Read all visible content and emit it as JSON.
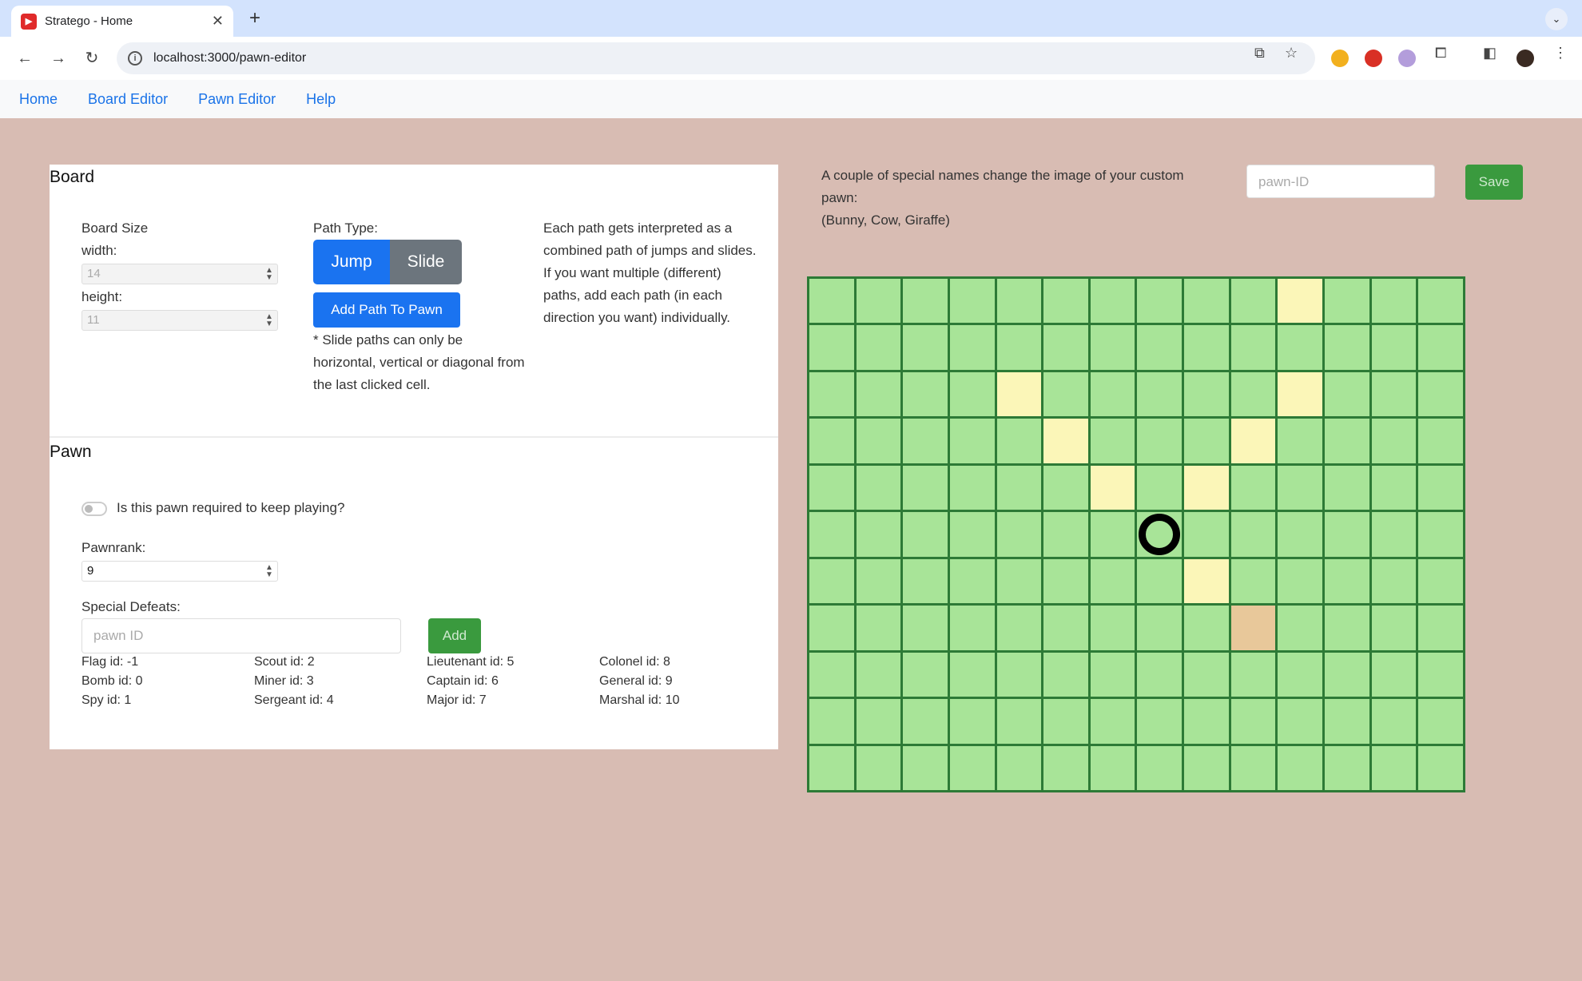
{
  "browser": {
    "tab_title": "Stratego - Home",
    "tab_close": "✕",
    "new_tab": "+",
    "url": "localhost:3000/pawn-editor"
  },
  "nav": {
    "links": [
      "Home",
      "Board Editor",
      "Pawn Editor",
      "Help"
    ]
  },
  "board_section": {
    "title": "Board",
    "board_size_label": "Board Size",
    "width_label": "width:",
    "width_value": "14",
    "height_label": "height:",
    "height_value": "11",
    "path_type_label": "Path Type:",
    "jump_label": "Jump",
    "slide_label": "Slide",
    "add_path_label": "Add Path To Pawn",
    "slide_note": "* Slide paths can only be horizontal, vertical or diagonal from the last clicked cell.",
    "path_info": "Each path gets interpreted as a combined path of jumps and slides. If you want multiple (different) paths, add each path (in each direction you want) individually."
  },
  "pawn_section": {
    "title": "Pawn",
    "required_label": "Is this pawn required to keep playing?",
    "required": false,
    "pawnrank_label": "Pawnrank:",
    "pawnrank_value": "9",
    "special_defeats_label": "Special Defeats:",
    "special_defeats_placeholder": "pawn ID",
    "add_label": "Add",
    "ids": [
      "Flag id: -1",
      "Scout id: 2",
      "Lieutenant id: 5",
      "Colonel id: 8",
      "Bomb id: 0",
      "Miner id: 3",
      "Captain id: 6",
      "General id: 9",
      "Spy id: 1",
      "Sergeant id: 4",
      "Major id: 7",
      "Marshal id: 10"
    ]
  },
  "right": {
    "note_line1": "A couple of special names change the image of your custom pawn:",
    "note_line2": "(Bunny, Cow, Giraffe)",
    "id_placeholder": "pawn-ID",
    "save_label": "Save"
  },
  "grid": {
    "cols": 14,
    "rows": 11,
    "pawn": [
      5,
      7
    ],
    "path_cells": [
      [
        0,
        10
      ],
      [
        2,
        4
      ],
      [
        2,
        10
      ],
      [
        3,
        5
      ],
      [
        3,
        9
      ],
      [
        4,
        6
      ],
      [
        4,
        8
      ],
      [
        6,
        8
      ]
    ],
    "current_cell": [
      7,
      9
    ]
  },
  "colors": {
    "cell": "#a8e498",
    "path": "#fbf6b8",
    "current": "#e8c89a",
    "grid_line": "#2d7a36",
    "background": "#d8bcb3"
  }
}
